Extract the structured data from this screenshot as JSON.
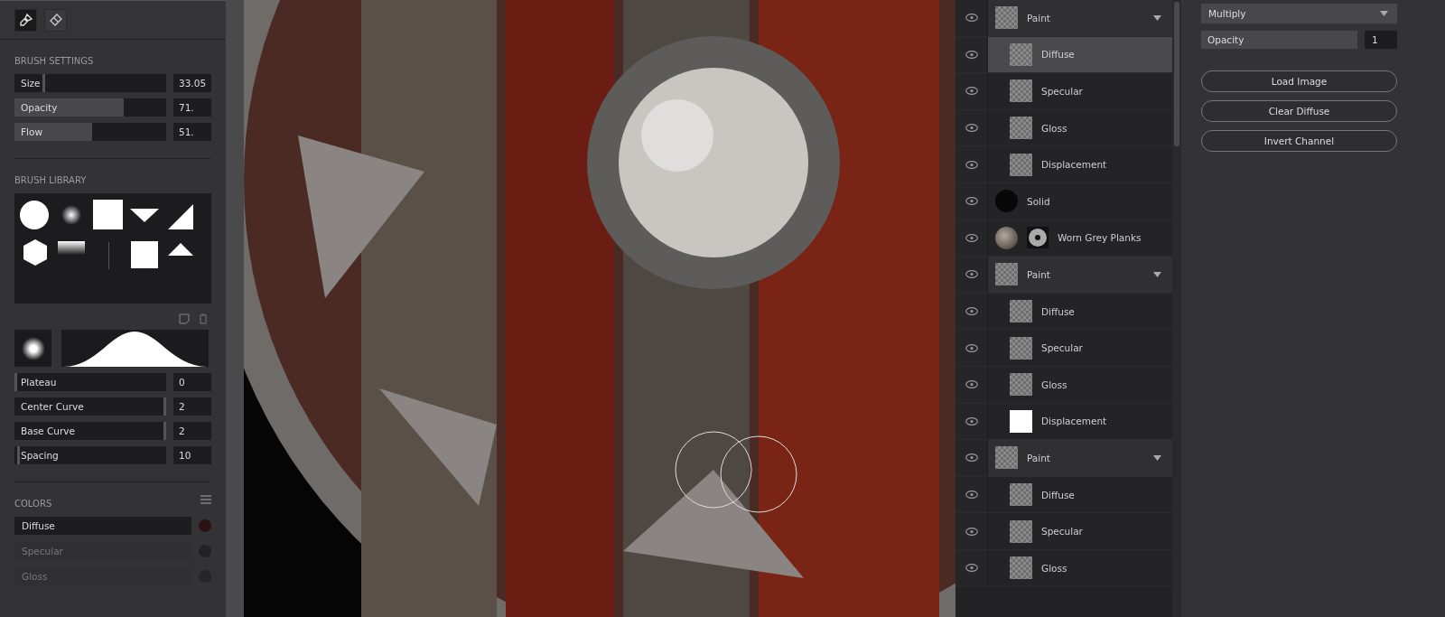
{
  "tools": [
    {
      "kind": "brush",
      "selected": true
    },
    {
      "kind": "eraser",
      "selected": false
    }
  ],
  "brush_settings": {
    "title": "BRUSH SETTINGS",
    "sliders": [
      {
        "label": "Size",
        "level": 0.19,
        "value": "33.05",
        "kind": "marker"
      },
      {
        "label": "Opacity",
        "level": 0.72,
        "value": "71.",
        "kind": "fill"
      },
      {
        "label": "Flow",
        "level": 0.51,
        "value": "51.",
        "kind": "fill"
      }
    ]
  },
  "brush_library": {
    "title": "BRUSH LIBRARY"
  },
  "brush_shape": {
    "sliders": [
      {
        "label": "Plateau",
        "level": 0.0,
        "value": "0",
        "kind": "marker"
      },
      {
        "label": "Center Curve",
        "level": 1.0,
        "value": "2",
        "kind": "marker"
      },
      {
        "label": "Base Curve",
        "level": 1.0,
        "value": "2",
        "kind": "marker"
      },
      {
        "label": "Spacing",
        "level": 0.02,
        "value": "10",
        "kind": "marker"
      }
    ]
  },
  "colors": {
    "title": "COLORS",
    "items": [
      {
        "label": "Diffuse",
        "selected": true,
        "color": "#2a1212"
      },
      {
        "label": "Specular",
        "selected": false,
        "color": "#222224"
      },
      {
        "label": "Gloss",
        "selected": false,
        "color": "#252527"
      }
    ]
  },
  "layers": [
    {
      "name": "Paint",
      "kind": "transparent",
      "selected": false,
      "expanded": true,
      "children": [
        {
          "name": "Diffuse",
          "kind": "transparent",
          "selected": true
        },
        {
          "name": "Specular",
          "kind": "transparent",
          "selected": false
        },
        {
          "name": "Gloss",
          "kind": "transparent",
          "selected": false
        },
        {
          "name": "Displacement",
          "kind": "transparent",
          "selected": false
        }
      ]
    },
    {
      "name": "Solid",
      "kind": "solid",
      "selected": false
    },
    {
      "name": "Worn Grey Planks",
      "kind": "material",
      "selected": false
    },
    {
      "name": "Paint",
      "kind": "transparent",
      "selected": false,
      "expanded": true,
      "children": [
        {
          "name": "Diffuse",
          "kind": "transparent",
          "selected": false
        },
        {
          "name": "Specular",
          "kind": "transparent",
          "selected": false
        },
        {
          "name": "Gloss",
          "kind": "transparent",
          "selected": false
        },
        {
          "name": "Displacement",
          "kind": "white",
          "selected": false
        }
      ]
    },
    {
      "name": "Paint",
      "kind": "transparent",
      "selected": false,
      "expanded": true,
      "children": [
        {
          "name": "Diffuse",
          "kind": "transparent",
          "selected": false
        },
        {
          "name": "Specular",
          "kind": "transparent",
          "selected": false
        },
        {
          "name": "Gloss",
          "kind": "transparent",
          "selected": false
        }
      ]
    }
  ],
  "properties": {
    "blend_mode": "Multiply",
    "opacity_label": "Opacity",
    "opacity_value": "1",
    "buttons": [
      "Load Image",
      "Clear Diffuse",
      "Invert Channel"
    ]
  }
}
